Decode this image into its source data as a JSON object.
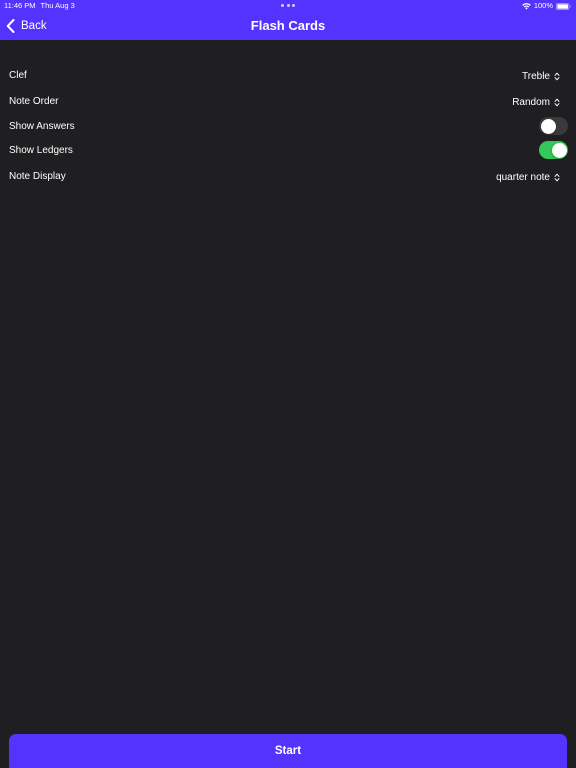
{
  "status_bar": {
    "time": "11:46 PM",
    "date": "Thu Aug 3",
    "battery": "100%",
    "icons": [
      "more-dots-icon",
      "wifi-icon",
      "battery-icon"
    ]
  },
  "nav": {
    "back_label": "Back",
    "back_icon": "chevron-left-icon",
    "title": "Flash Cards"
  },
  "settings": {
    "clef": {
      "label": "Clef",
      "value": "Treble"
    },
    "note_order": {
      "label": "Note Order",
      "value": "Random"
    },
    "show_answers": {
      "label": "Show Answers",
      "on": false
    },
    "show_ledgers": {
      "label": "Show Ledgers",
      "on": true
    },
    "note_display": {
      "label": "Note Display",
      "value": "quarter note"
    }
  },
  "start_button": {
    "label": "Start"
  },
  "colors": {
    "accent": "#5533ff",
    "background": "#1f1f21",
    "toggle_on": "#34c759",
    "toggle_off": "#3a3a3d"
  }
}
